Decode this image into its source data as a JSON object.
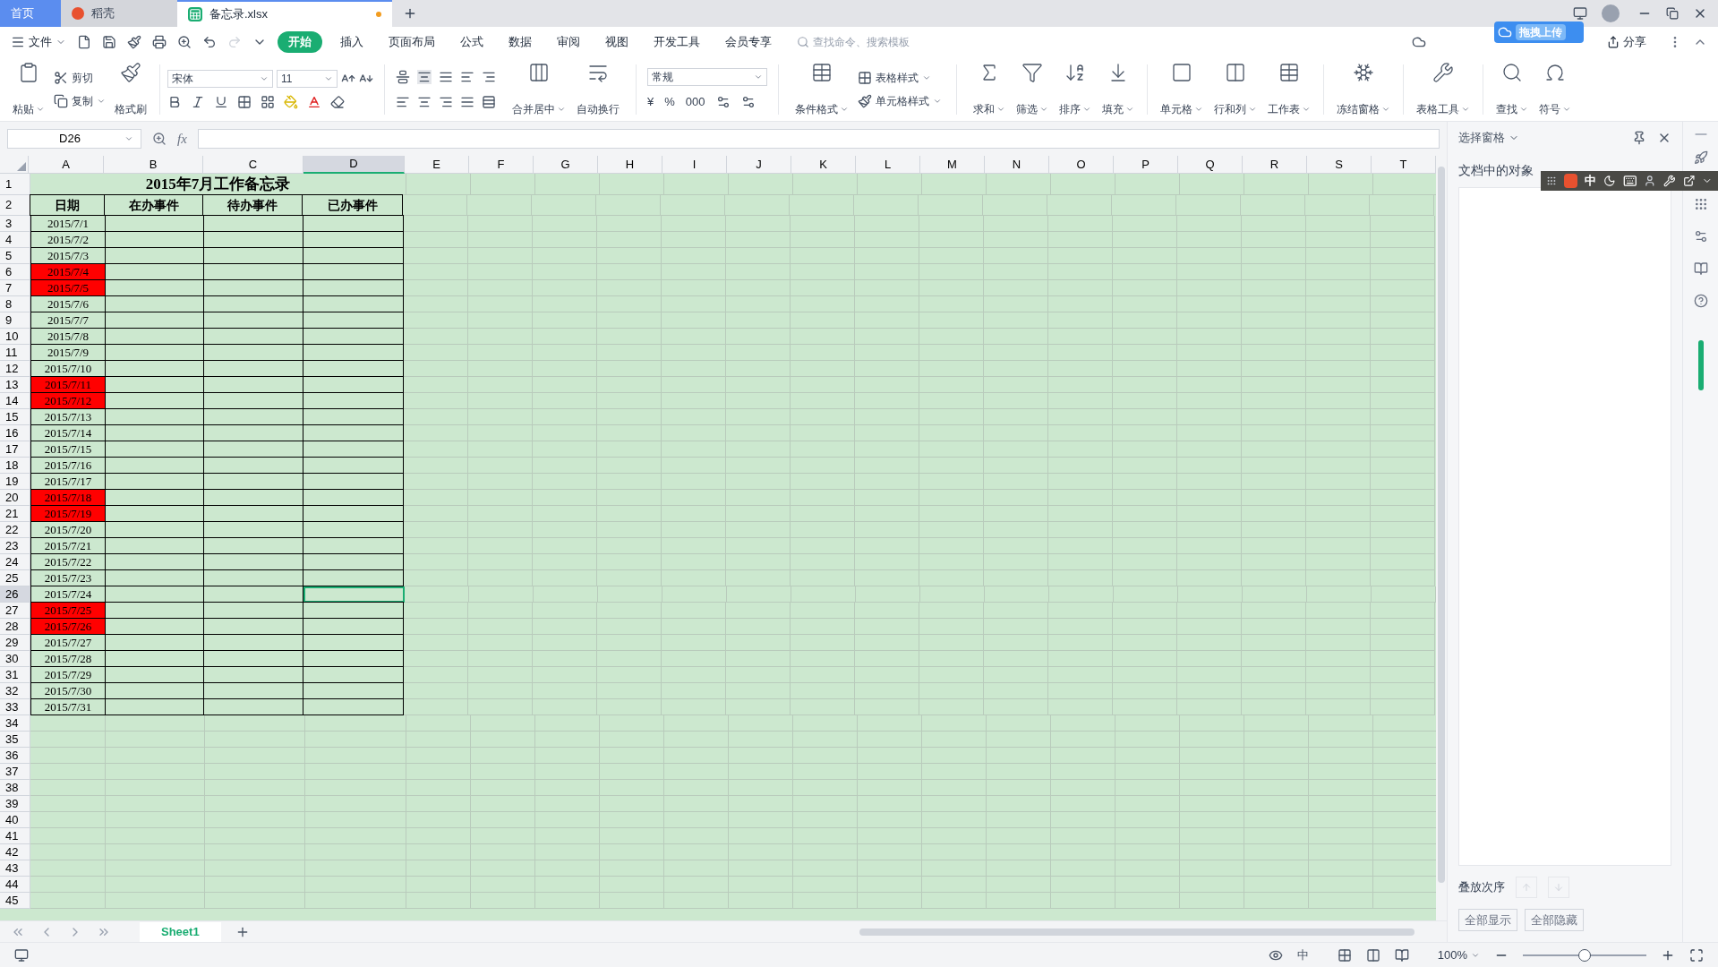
{
  "title_tabs": [
    {
      "label": "首页",
      "selected": false,
      "kind": "home"
    },
    {
      "label": "稻壳",
      "selected": false,
      "kind": "docer"
    },
    {
      "label": "备忘录.xlsx",
      "selected": true,
      "kind": "file",
      "modified": true
    }
  ],
  "menu": {
    "file": "文件",
    "tabs": [
      {
        "label": "开始",
        "selected": true
      },
      {
        "label": "插入",
        "selected": false
      },
      {
        "label": "页面布局",
        "selected": false
      },
      {
        "label": "公式",
        "selected": false
      },
      {
        "label": "数据",
        "selected": false
      },
      {
        "label": "审阅",
        "selected": false
      },
      {
        "label": "视图",
        "selected": false
      },
      {
        "label": "开发工具",
        "selected": false
      },
      {
        "label": "会员专享",
        "selected": false
      }
    ],
    "search": {
      "placeholder": "查找命令、搜索模板"
    },
    "upload_popup": "拖拽上传",
    "share": "分享"
  },
  "ribbon": {
    "clipboard": [
      {
        "label": "粘贴",
        "dropdown": true
      },
      {
        "label": "剪切",
        "dropdown": false
      },
      {
        "label": "复制",
        "dropdown": true
      },
      {
        "label": "格式刷",
        "dropdown": false
      }
    ],
    "font": {
      "name": "宋体",
      "size": "11"
    },
    "merge": [
      {
        "label": "合并居中",
        "dropdown": true
      },
      {
        "label": "自动换行",
        "dropdown": false
      }
    ],
    "number_format": "常规",
    "number_symbols": [
      "¥",
      "%",
      "000"
    ],
    "styles": [
      {
        "label": "条件格式",
        "dropdown": true
      },
      {
        "label": "表格样式",
        "dropdown": true
      },
      {
        "label": "单元格样式",
        "dropdown": true
      }
    ],
    "tools": [
      {
        "label": "求和",
        "dropdown": true
      },
      {
        "label": "筛选",
        "dropdown": true
      },
      {
        "label": "排序",
        "dropdown": true
      },
      {
        "label": "填充",
        "dropdown": true
      },
      {
        "label": "单元格",
        "dropdown": true
      },
      {
        "label": "行和列",
        "dropdown": true
      },
      {
        "label": "工作表",
        "dropdown": true
      },
      {
        "label": "冻结窗格",
        "dropdown": true
      },
      {
        "label": "表格工具",
        "dropdown": true
      },
      {
        "label": "查找",
        "dropdown": true
      },
      {
        "label": "符号",
        "dropdown": true
      }
    ]
  },
  "formula_bar": {
    "name_box": "D26",
    "fx": "fx"
  },
  "column_headers": [
    {
      "label": "A",
      "selected": false
    },
    {
      "label": "B",
      "selected": false
    },
    {
      "label": "C",
      "selected": false
    },
    {
      "label": "D",
      "selected": true
    },
    {
      "label": "E",
      "selected": false
    },
    {
      "label": "F",
      "selected": false
    },
    {
      "label": "G",
      "selected": false
    },
    {
      "label": "H",
      "selected": false
    },
    {
      "label": "I",
      "selected": false
    },
    {
      "label": "J",
      "selected": false
    },
    {
      "label": "K",
      "selected": false
    },
    {
      "label": "L",
      "selected": false
    },
    {
      "label": "M",
      "selected": false
    },
    {
      "label": "N",
      "selected": false
    },
    {
      "label": "O",
      "selected": false
    },
    {
      "label": "P",
      "selected": false
    },
    {
      "label": "Q",
      "selected": false
    },
    {
      "label": "R",
      "selected": false
    },
    {
      "label": "S",
      "selected": false
    },
    {
      "label": "T",
      "selected": false
    }
  ],
  "row_headers": [
    {
      "label": "1",
      "selected": false
    },
    {
      "label": "2",
      "selected": false
    },
    {
      "label": "3",
      "selected": false
    },
    {
      "label": "4",
      "selected": false
    },
    {
      "label": "5",
      "selected": false
    },
    {
      "label": "6",
      "selected": false
    },
    {
      "label": "7",
      "selected": false
    },
    {
      "label": "8",
      "selected": false
    },
    {
      "label": "9",
      "selected": false
    },
    {
      "label": "10",
      "selected": false
    },
    {
      "label": "11",
      "selected": false
    },
    {
      "label": "12",
      "selected": false
    },
    {
      "label": "13",
      "selected": false
    },
    {
      "label": "14",
      "selected": false
    },
    {
      "label": "15",
      "selected": false
    },
    {
      "label": "16",
      "selected": false
    },
    {
      "label": "17",
      "selected": false
    },
    {
      "label": "18",
      "selected": false
    },
    {
      "label": "19",
      "selected": false
    },
    {
      "label": "20",
      "selected": false
    },
    {
      "label": "21",
      "selected": false
    },
    {
      "label": "22",
      "selected": false
    },
    {
      "label": "23",
      "selected": false
    },
    {
      "label": "24",
      "selected": false
    },
    {
      "label": "25",
      "selected": false
    },
    {
      "label": "26",
      "selected": true
    },
    {
      "label": "27",
      "selected": false
    },
    {
      "label": "28",
      "selected": false
    },
    {
      "label": "29",
      "selected": false
    },
    {
      "label": "30",
      "selected": false
    },
    {
      "label": "31",
      "selected": false
    },
    {
      "label": "32",
      "selected": false
    },
    {
      "label": "33",
      "selected": false
    },
    {
      "label": "34",
      "selected": false
    },
    {
      "label": "35",
      "selected": false
    },
    {
      "label": "36",
      "selected": false
    },
    {
      "label": "37",
      "selected": false
    },
    {
      "label": "38",
      "selected": false
    },
    {
      "label": "39",
      "selected": false
    },
    {
      "label": "40",
      "selected": false
    },
    {
      "label": "41",
      "selected": false
    },
    {
      "label": "42",
      "selected": false
    },
    {
      "label": "43",
      "selected": false
    },
    {
      "label": "44",
      "selected": false
    },
    {
      "label": "45",
      "selected": false
    }
  ],
  "table": {
    "title": "2015年7月工作备忘录",
    "columns": [
      "日期",
      "在办事件",
      "待办事件",
      "已办事件"
    ],
    "rows": [
      {
        "date": "2015/7/1",
        "highlight": false
      },
      {
        "date": "2015/7/2",
        "highlight": false
      },
      {
        "date": "2015/7/3",
        "highlight": false
      },
      {
        "date": "2015/7/4",
        "highlight": true
      },
      {
        "date": "2015/7/5",
        "highlight": true
      },
      {
        "date": "2015/7/6",
        "highlight": false
      },
      {
        "date": "2015/7/7",
        "highlight": false
      },
      {
        "date": "2015/7/8",
        "highlight": false
      },
      {
        "date": "2015/7/9",
        "highlight": false
      },
      {
        "date": "2015/7/10",
        "highlight": false
      },
      {
        "date": "2015/7/11",
        "highlight": true
      },
      {
        "date": "2015/7/12",
        "highlight": true
      },
      {
        "date": "2015/7/13",
        "highlight": false
      },
      {
        "date": "2015/7/14",
        "highlight": false
      },
      {
        "date": "2015/7/15",
        "highlight": false
      },
      {
        "date": "2015/7/16",
        "highlight": false
      },
      {
        "date": "2015/7/17",
        "highlight": false
      },
      {
        "date": "2015/7/18",
        "highlight": true
      },
      {
        "date": "2015/7/19",
        "highlight": true
      },
      {
        "date": "2015/7/20",
        "highlight": false
      },
      {
        "date": "2015/7/21",
        "highlight": false
      },
      {
        "date": "2015/7/22",
        "highlight": false
      },
      {
        "date": "2015/7/23",
        "highlight": false
      },
      {
        "date": "2015/7/24",
        "highlight": false
      },
      {
        "date": "2015/7/25",
        "highlight": true
      },
      {
        "date": "2015/7/26",
        "highlight": true
      },
      {
        "date": "2015/7/27",
        "highlight": false
      },
      {
        "date": "2015/7/28",
        "highlight": false
      },
      {
        "date": "2015/7/29",
        "highlight": false
      },
      {
        "date": "2015/7/30",
        "highlight": false
      },
      {
        "date": "2015/7/31",
        "highlight": false
      }
    ]
  },
  "sheet_tabs": [
    {
      "label": "Sheet1",
      "selected": true
    }
  ],
  "side_panel": {
    "title": "选择窗格",
    "subtitle": "文档中的对象",
    "order_label": "叠放次序",
    "buttons": [
      {
        "label": "全部显示",
        "disabled": true
      },
      {
        "label": "全部隐藏",
        "disabled": true
      }
    ]
  },
  "ime_bar": {
    "mode": "中"
  },
  "status_bar": {
    "input": "中",
    "zoom": "100%",
    "level": 0.5
  }
}
